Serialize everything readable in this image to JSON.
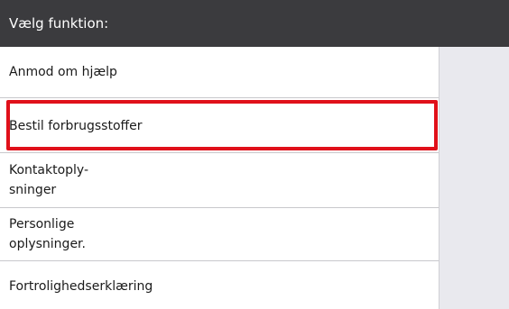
{
  "header": {
    "title": "Vælg funktion:"
  },
  "menu": {
    "items": [
      {
        "lines": [
          "Anmod om hjælp"
        ]
      },
      {
        "lines": [
          "Bestil forbrugsstoffer"
        ]
      },
      {
        "lines": [
          "Kontaktoply-",
          "sninger"
        ]
      },
      {
        "lines": [
          "Personlige",
          "oplysninger."
        ]
      },
      {
        "lines": [
          "Fortrolighedserklæring"
        ]
      }
    ],
    "highlighted_item": "Bestil forbrugsstoffer"
  },
  "colors": {
    "header_bg": "#3b3b3e",
    "side_panel_bg": "#e9e9ee",
    "highlight": "#e0101a"
  }
}
